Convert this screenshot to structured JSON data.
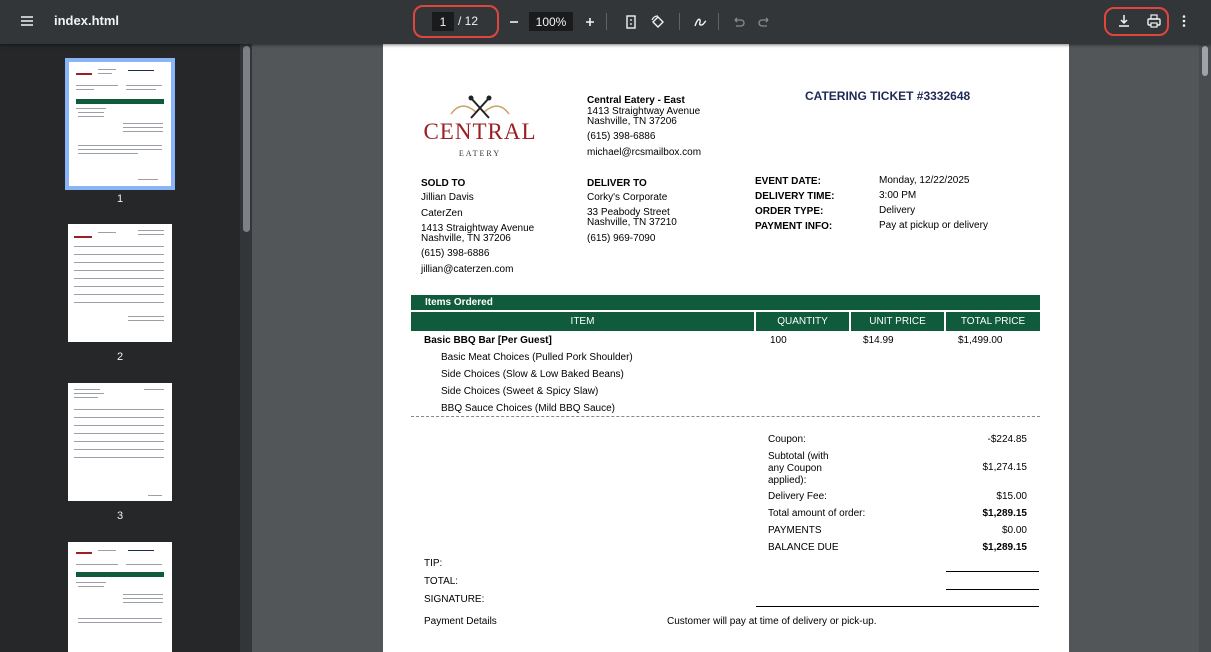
{
  "toolbar": {
    "title": "index.html",
    "page_current": "1",
    "page_total": "/ 12",
    "zoom": "100%",
    "icons": [
      "menu-icon",
      "zoom-out-icon",
      "zoom-in-icon",
      "fit-page-icon",
      "rotate-icon",
      "annotate-icon",
      "undo-icon",
      "redo-icon",
      "download-icon",
      "print-icon",
      "more-vert-icon"
    ]
  },
  "sidebar": {
    "thumbnails": [
      {
        "label": "1",
        "selected": true
      },
      {
        "label": "2",
        "selected": false
      },
      {
        "label": "3",
        "selected": false
      }
    ]
  },
  "document": {
    "logo": {
      "name": "CENTRAL",
      "sub": "EATERY"
    },
    "ticket_title": "CATERING TICKET #3332648",
    "store": {
      "name": "Central Eatery - East",
      "address1": "1413 Straightway Avenue",
      "address2": "Nashville, TN 37206",
      "phone": "(615) 398-6886",
      "email": "michael@rcsmailbox.com"
    },
    "sold_to": {
      "heading": "SOLD TO",
      "name": "Jillian Davis",
      "company": "CaterZen",
      "address1": "1413 Straightway Avenue",
      "address2": "Nashville, TN 37206",
      "phone": "(615) 398-6886",
      "email": "jillian@caterzen.com"
    },
    "deliver_to": {
      "heading": "DELIVER TO",
      "company": "Corky's Corporate",
      "address1": "33 Peabody Street",
      "address2": "Nashville, TN 37210",
      "phone": "(615) 969-7090"
    },
    "event": {
      "date_label": "EVENT DATE:",
      "date": "Monday, 12/22/2025",
      "time_label": "DELIVERY TIME:",
      "time": "3:00 PM",
      "type_label": "ORDER TYPE:",
      "type": "Delivery",
      "payment_label": "PAYMENT INFO:",
      "payment": "Pay at pickup or delivery"
    },
    "items_section": {
      "heading": "Items Ordered",
      "columns": [
        "ITEM",
        "QUANTITY",
        "UNIT PRICE",
        "TOTAL PRICE"
      ],
      "item": {
        "name": "Basic BBQ Bar [Per Guest]",
        "quantity": "100",
        "unit_price": "$14.99",
        "total_price": "$1,499.00",
        "options": [
          "Basic Meat Choices (Pulled Pork Shoulder)",
          "Side Choices (Slow & Low Baked Beans)",
          "Side Choices (Sweet & Spicy Slaw)",
          "BBQ Sauce Choices (Mild BBQ Sauce)"
        ]
      }
    },
    "totals": {
      "coupon_label": "Coupon:",
      "coupon": "-$224.85",
      "subtotal_label_1": "Subtotal (with",
      "subtotal_label_2": "any Coupon",
      "subtotal_label_3": "applied):",
      "subtotal": "$1,274.15",
      "delivery_label": "Delivery Fee:",
      "delivery": "$15.00",
      "total_label": "Total amount of order:",
      "total": "$1,289.15",
      "payments_label": "PAYMENTS",
      "payments": "$0.00",
      "balance_label": "BALANCE DUE",
      "balance": "$1,289.15"
    },
    "footer": {
      "tip_label": "TIP:",
      "total_label": "TOTAL:",
      "signature_label": "SIGNATURE:",
      "payment_details_label": "Payment Details",
      "payment_details": "Customer will pay at time of delivery or pick-up."
    }
  }
}
